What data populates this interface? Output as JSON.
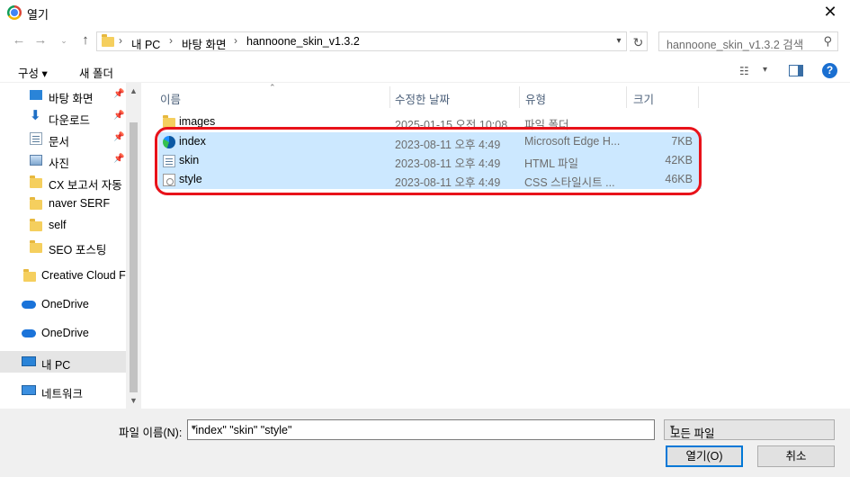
{
  "window": {
    "title": "열기",
    "close_glyph": "✕"
  },
  "address": {
    "crumbs": [
      "내 PC",
      "바탕 화면",
      "hannoone_skin_v1.3.2"
    ],
    "separator": "›",
    "search_placeholder": "hannoone_skin_v1.3.2 검색"
  },
  "toolbar": {
    "organize": "구성 ▾",
    "new_folder": "새 폴더"
  },
  "sidebar": {
    "items": [
      {
        "label": "바탕 화면",
        "icon": "desktop-icon",
        "pinned": true
      },
      {
        "label": "다운로드",
        "icon": "download-icon",
        "pinned": true
      },
      {
        "label": "문서",
        "icon": "document-icon",
        "pinned": true
      },
      {
        "label": "사진",
        "icon": "picture-icon",
        "pinned": true
      },
      {
        "label": "CX 보고서 자동",
        "icon": "folder-icon",
        "pinned": false
      },
      {
        "label": "naver SERF",
        "icon": "folder-icon",
        "pinned": false
      },
      {
        "label": "self",
        "icon": "folder-icon",
        "pinned": false
      },
      {
        "label": "SEO 포스팅",
        "icon": "folder-icon",
        "pinned": false
      },
      {
        "label": "Creative Cloud Fil",
        "icon": "creative-cloud-icon",
        "pinned": false
      },
      {
        "label": "OneDrive",
        "icon": "onedrive-icon",
        "pinned": false
      },
      {
        "label": "OneDrive",
        "icon": "onedrive-icon",
        "pinned": false
      },
      {
        "label": "내 PC",
        "icon": "pc-icon",
        "pinned": false,
        "selected": true
      },
      {
        "label": "네트워크",
        "icon": "network-icon",
        "pinned": false
      }
    ]
  },
  "columns": {
    "name": "이름",
    "modified": "수정한 날짜",
    "type": "유형",
    "size": "크기"
  },
  "files": [
    {
      "name": "images",
      "modified": "2025-01-15 오전 10:08",
      "type": "파일 폴더",
      "size": "",
      "icon": "folder-icon",
      "selected": false
    },
    {
      "name": "index",
      "modified": "2023-08-11 오후 4:49",
      "type": "Microsoft Edge H...",
      "size": "7KB",
      "icon": "edge-html-icon",
      "selected": true
    },
    {
      "name": "skin",
      "modified": "2023-08-11 오후 4:49",
      "type": "HTML 파일",
      "size": "42KB",
      "icon": "html-file-icon",
      "selected": true
    },
    {
      "name": "style",
      "modified": "2023-08-11 오후 4:49",
      "type": "CSS 스타일시트 ...",
      "size": "46KB",
      "icon": "css-file-icon",
      "selected": true
    }
  ],
  "footer": {
    "filename_label": "파일 이름(N):",
    "filename_value": "\"index\" \"skin\" \"style\"",
    "filetype_value": "모든 파일",
    "open_button": "열기(O)",
    "cancel_button": "취소"
  },
  "colors": {
    "selection": "#cce8ff",
    "highlight_ring": "#e8121a",
    "accent": "#0078d7"
  }
}
